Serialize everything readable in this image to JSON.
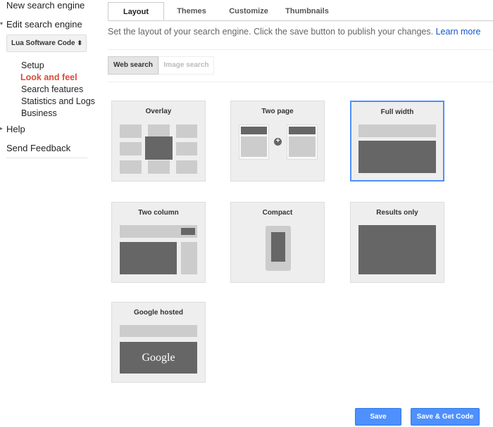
{
  "sidebar": {
    "new_engine": "New search engine",
    "edit_engine": "Edit search engine",
    "engine_select": "Lua Software Code",
    "items": [
      {
        "label": "Setup"
      },
      {
        "label": "Look and feel",
        "active": true
      },
      {
        "label": "Search features"
      },
      {
        "label": "Statistics and Logs"
      },
      {
        "label": "Business"
      }
    ],
    "help": "Help",
    "feedback": "Send Feedback"
  },
  "tabs": [
    "Layout",
    "Themes",
    "Customize",
    "Thumbnails"
  ],
  "description": "Set the layout of your search engine. Click the save button to publish your changes.",
  "learn_more": "Learn more",
  "search_type": {
    "web": "Web search",
    "image": "Image search",
    "selected": "Web search"
  },
  "layouts": [
    "Overlay",
    "Two page",
    "Full width",
    "Two column",
    "Compact",
    "Results only",
    "Google hosted"
  ],
  "selected_layout": "Full width",
  "google_logo": "Google",
  "buttons": {
    "save": "Save",
    "save_get_code": "Save & Get Code"
  },
  "colors": {
    "accent": "#4d90fe",
    "active_nav": "#dd4b39",
    "link": "#1155cc"
  }
}
